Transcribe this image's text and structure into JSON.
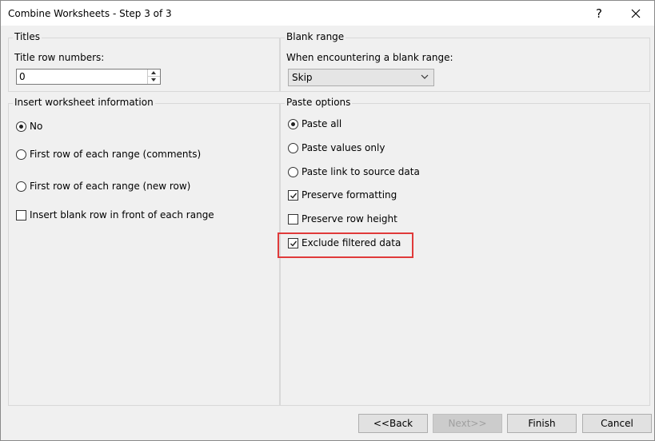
{
  "window": {
    "title": "Combine Worksheets - Step 3 of 3",
    "help_label": "?",
    "close_icon": "close-icon"
  },
  "titles": {
    "group_label": "Titles",
    "row_numbers_label": "Title row numbers:",
    "row_numbers_value": "0"
  },
  "blank_range": {
    "group_label": "Blank range",
    "prompt": "When encountering a blank range:",
    "selected": "Skip"
  },
  "insert_info": {
    "group_label": "Insert worksheet information",
    "options": [
      {
        "label": "No",
        "type": "radio",
        "checked": true
      },
      {
        "label": "First row of each range (comments)",
        "type": "radio",
        "checked": false
      },
      {
        "label": "First row of each range (new row)",
        "type": "radio",
        "checked": false
      },
      {
        "label": "Insert blank row in front of each range",
        "type": "checkbox",
        "checked": false
      }
    ]
  },
  "paste_options": {
    "group_label": "Paste options",
    "options": [
      {
        "label": "Paste all",
        "type": "radio",
        "checked": true
      },
      {
        "label": "Paste values only",
        "type": "radio",
        "checked": false
      },
      {
        "label": "Paste link to source data",
        "type": "radio",
        "checked": false
      },
      {
        "label": "Preserve formatting",
        "type": "checkbox",
        "checked": true
      },
      {
        "label": "Preserve row height",
        "type": "checkbox",
        "checked": false
      },
      {
        "label": "Exclude filtered data",
        "type": "checkbox",
        "checked": true
      }
    ]
  },
  "footer": {
    "back_label": "<<Back",
    "next_label": "Next>>",
    "finish_label": "Finish",
    "cancel_label": "Cancel"
  },
  "colors": {
    "highlight": "#e03a3a",
    "window_bg": "#f0f0f0"
  }
}
